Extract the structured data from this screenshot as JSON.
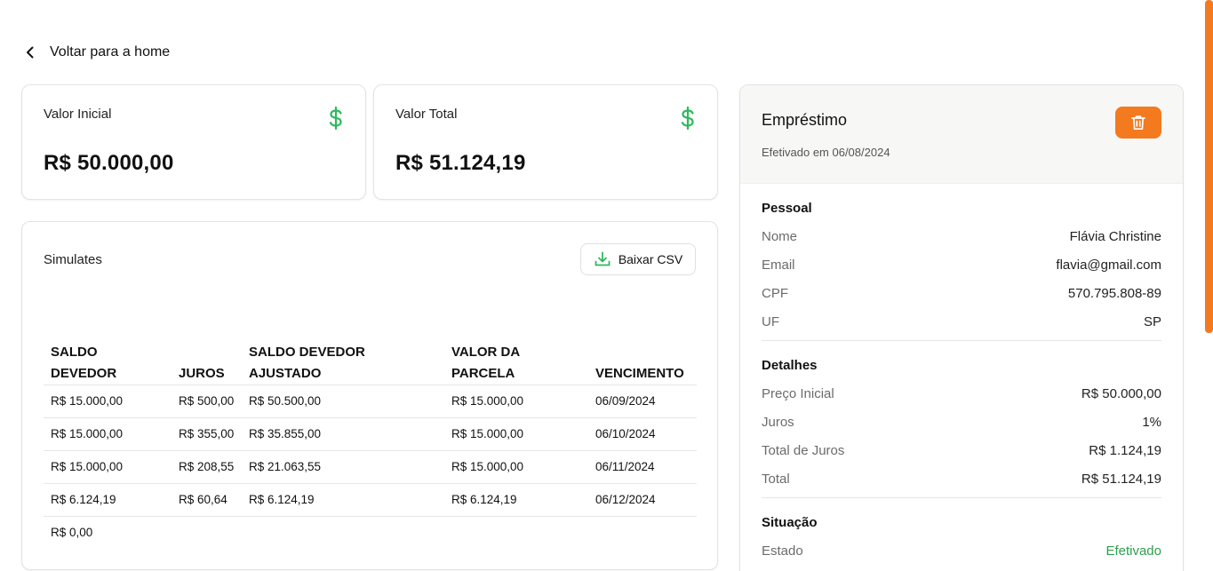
{
  "back": {
    "label": "Voltar para a home"
  },
  "cards": {
    "inicial": {
      "label": "Valor Inicial",
      "value": "R$ 50.000,00",
      "icon": "dollar-icon"
    },
    "total": {
      "label": "Valor Total",
      "value": "R$ 51.124,19",
      "icon": "dollar-icon"
    }
  },
  "simulates": {
    "title": "Simulates",
    "csv_label": "Baixar CSV",
    "columns": [
      "SALDO DEVEDOR",
      "JUROS",
      "SALDO DEVEDOR AJUSTADO",
      "VALOR DA PARCELA",
      "VENCIMENTO"
    ],
    "rows": [
      [
        "R$ 15.000,00",
        "R$ 500,00",
        "R$ 50.500,00",
        "R$ 15.000,00",
        "06/09/2024"
      ],
      [
        "R$ 15.000,00",
        "R$ 355,00",
        "R$ 35.855,00",
        "R$ 15.000,00",
        "06/10/2024"
      ],
      [
        "R$ 15.000,00",
        "R$ 208,55",
        "R$ 21.063,55",
        "R$ 15.000,00",
        "06/11/2024"
      ],
      [
        "R$ 6.124,19",
        "R$ 60,64",
        "R$ 6.124,19",
        "R$ 6.124,19",
        "06/12/2024"
      ],
      [
        "R$ 0,00",
        "",
        "",
        "",
        ""
      ]
    ]
  },
  "loan": {
    "title": "Empréstimo",
    "subtitle": "Efetivado em 06/08/2024",
    "pessoal": {
      "title": "Pessoal",
      "rows": [
        {
          "k": "Nome",
          "v": "Flávia Christine"
        },
        {
          "k": "Email",
          "v": "flavia@gmail.com"
        },
        {
          "k": "CPF",
          "v": "570.795.808-89"
        },
        {
          "k": "UF",
          "v": "SP"
        }
      ]
    },
    "detalhes": {
      "title": "Detalhes",
      "rows": [
        {
          "k": "Preço Inicial",
          "v": "R$ 50.000,00"
        },
        {
          "k": "Juros",
          "v": "1%"
        },
        {
          "k": "Total de Juros",
          "v": "R$ 1.124,19"
        },
        {
          "k": "Total",
          "v": "R$ 51.124,19"
        }
      ]
    },
    "situacao": {
      "title": "Situação",
      "rows": [
        {
          "k": "Estado",
          "v": "Efetivado"
        }
      ]
    }
  },
  "colors": {
    "accent": "#f47a1f",
    "dollar": "#2eb85c",
    "status": "#2e9e4f"
  }
}
